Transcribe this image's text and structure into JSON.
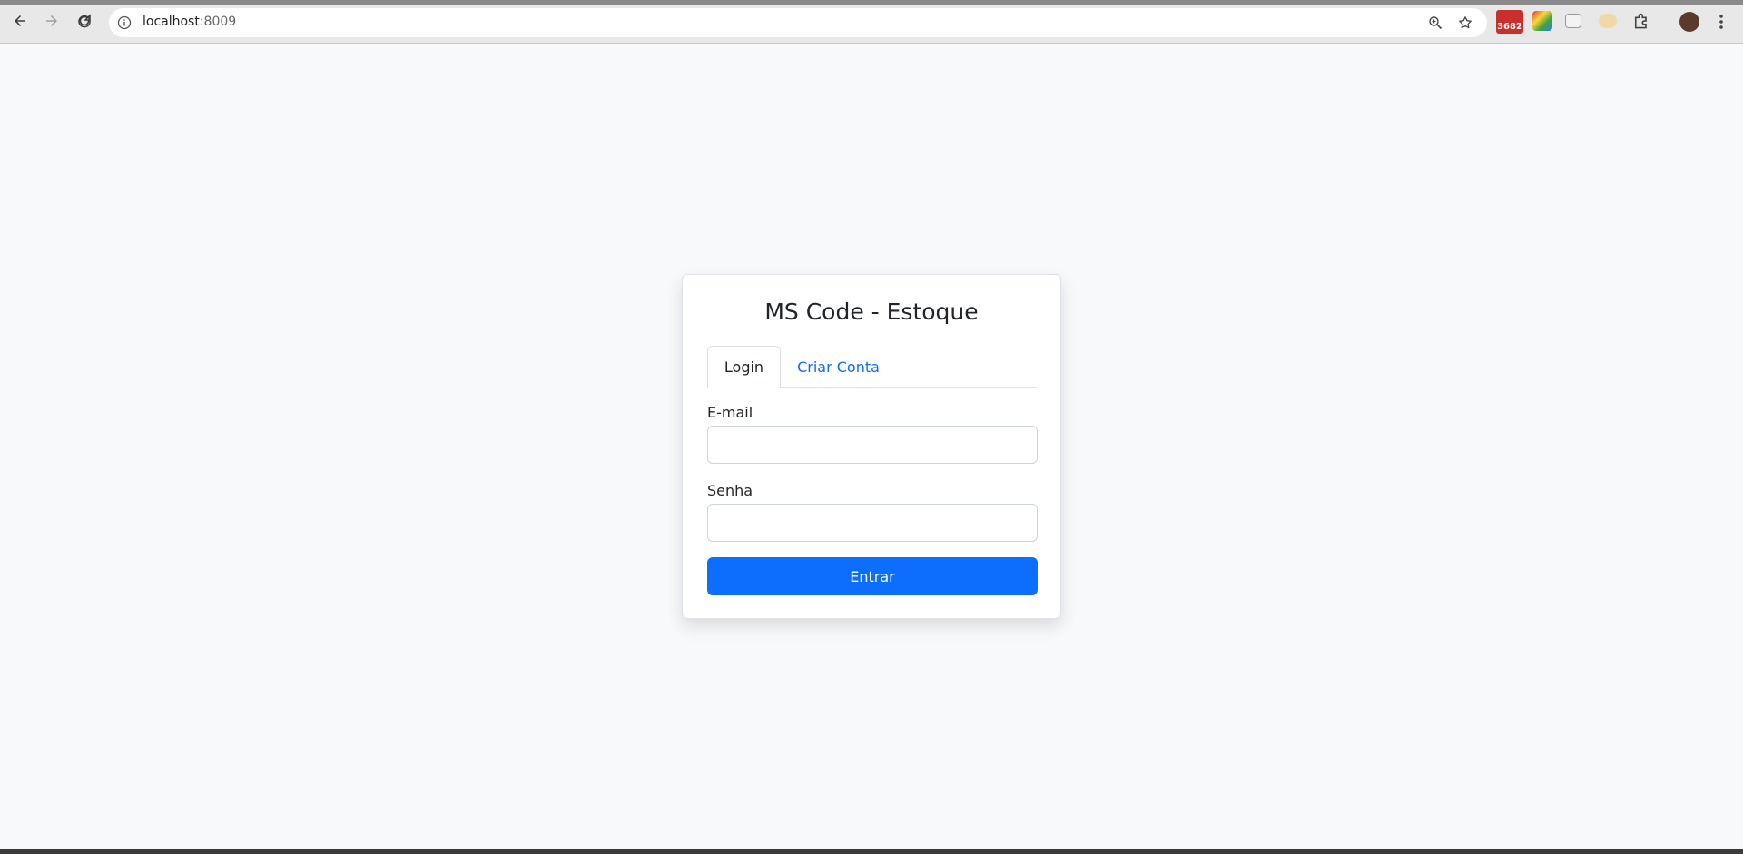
{
  "browser": {
    "url_host": "localhost",
    "url_port": ":8009",
    "extension_badge": "3682"
  },
  "card": {
    "title": "MS Code - Estoque",
    "tabs": [
      {
        "label": "Login",
        "active": true
      },
      {
        "label": "Criar Conta",
        "active": false
      }
    ],
    "email_label": "E-mail",
    "email_value": "",
    "password_label": "Senha",
    "password_value": "",
    "submit_label": "Entrar"
  },
  "colors": {
    "primary": "#0d6efd",
    "page_bg": "#f8f9fa"
  }
}
